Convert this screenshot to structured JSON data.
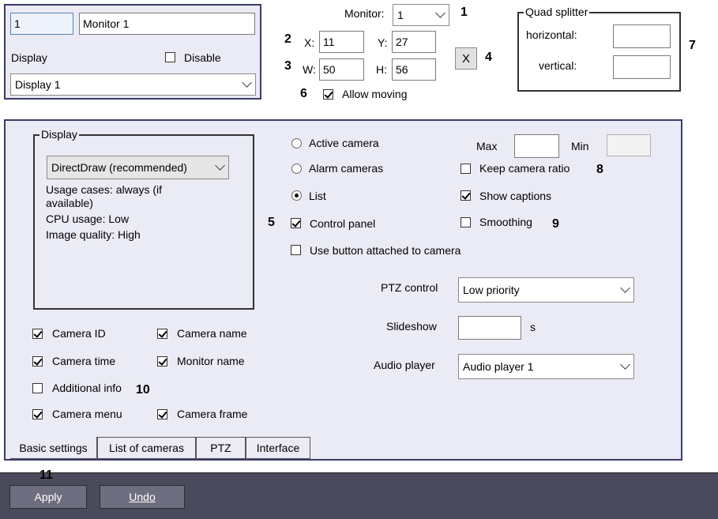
{
  "top_left": {
    "id_value": "1",
    "name_value": "Monitor 1",
    "display_label": "Display",
    "disable_label": "Disable",
    "display_select": "Display 1"
  },
  "monitor": {
    "monitor_label": "Monitor:",
    "monitor_value": "1",
    "x_label": "X:",
    "x_value": "11",
    "y_label": "Y:",
    "y_value": "27",
    "w_label": "W:",
    "w_value": "50",
    "h_label": "H:",
    "h_value": "56",
    "close_label": "X",
    "allow_moving_label": "Allow moving"
  },
  "quad_splitter": {
    "title": "Quad splitter",
    "horizontal_label": "horizontal:",
    "vertical_label": "vertical:",
    "horizontal_value": "",
    "vertical_value": ""
  },
  "display_group": {
    "title": "Display",
    "renderer": "DirectDraw (recommended)",
    "usage_cases": "Usage cases: always (if available)",
    "cpu_usage": "CPU usage: Low",
    "image_quality": "Image quality: High"
  },
  "modes": {
    "active_camera": "Active camera",
    "alarm_cameras": "Alarm cameras",
    "list": "List",
    "control_panel": "Control panel",
    "use_button": "Use button attached to camera"
  },
  "options": {
    "max_label": "Max",
    "min_label": "Min",
    "max_value": "",
    "min_value": "",
    "keep_ratio": "Keep camera ratio",
    "show_captions": "Show captions",
    "smoothing": "Smoothing"
  },
  "controls": {
    "ptz_label": "PTZ control",
    "ptz_value": "Low priority",
    "slideshow_label": "Slideshow",
    "slideshow_value": "",
    "slideshow_unit": "s",
    "audio_label": "Audio player",
    "audio_value": "Audio player 1"
  },
  "captions": {
    "camera_id": "Camera ID",
    "camera_name": "Camera name",
    "camera_time": "Camera time",
    "monitor_name": "Monitor name",
    "additional_info": "Additional info",
    "camera_menu": "Camera menu",
    "camera_frame": "Camera frame"
  },
  "tabs": [
    "Basic settings",
    "List of cameras",
    "PTZ",
    "Interface"
  ],
  "buttons": {
    "apply": "Apply",
    "undo": "Undo"
  },
  "callouts": [
    "1",
    "2",
    "3",
    "4",
    "5",
    "6",
    "7",
    "8",
    "9",
    "10",
    "11"
  ],
  "colors": {
    "panel_bg": "#ebebf5",
    "panel_border": "#3b3b6a",
    "bottom_bar": "#4a4a5c"
  }
}
